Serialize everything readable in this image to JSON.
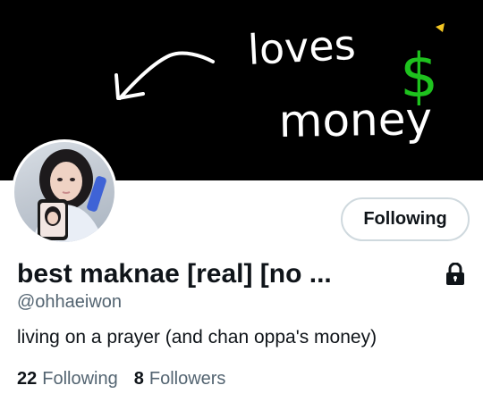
{
  "banner": {
    "text_line1": "loves",
    "dollar_sign": "$",
    "text_line2": "money"
  },
  "profile": {
    "display_name": "best maknae [real] [no ...",
    "handle": "@ohhaeiwon",
    "bio": "living on a prayer (and chan oppa's money)",
    "follow_button_label": "Following",
    "stats": {
      "following_count": "22",
      "following_label": "Following",
      "followers_count": "8",
      "followers_label": "Followers"
    }
  },
  "icons": {
    "lock": "lock-icon",
    "arrow": "arrow-icon"
  },
  "colors": {
    "banner_bg": "#000000",
    "banner_text": "#ffffff",
    "dollar": "#1ec21e",
    "text_primary": "#0f1419",
    "text_secondary": "#536471",
    "button_border": "#cfd9de"
  }
}
